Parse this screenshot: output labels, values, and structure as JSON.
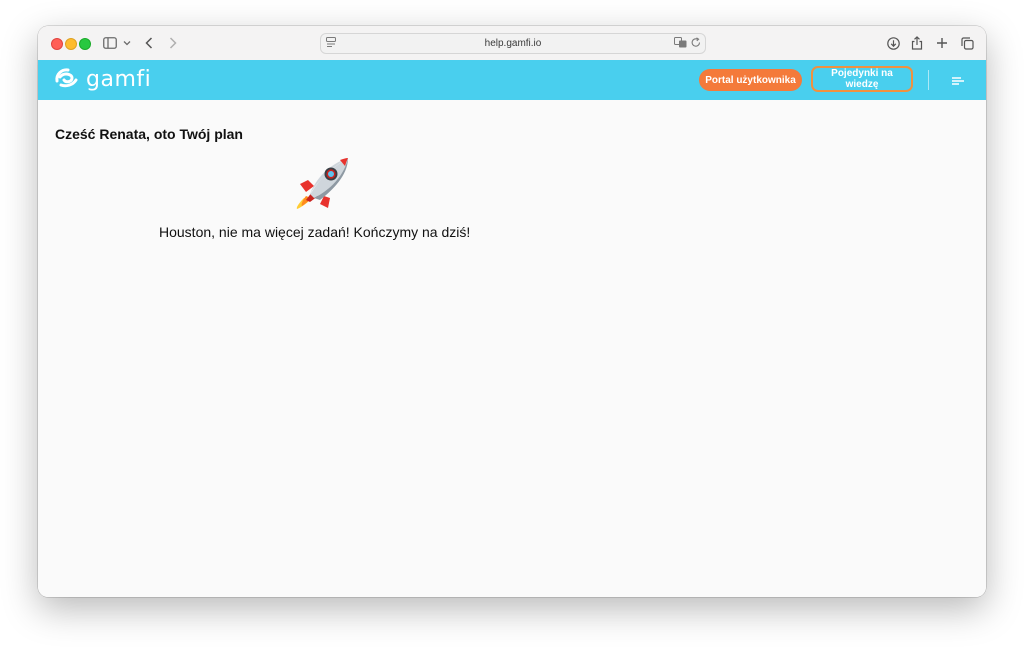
{
  "browser": {
    "url": "help.gamfi.io",
    "icons": [
      "sidebar-icon",
      "chevron-down-icon",
      "back-icon",
      "forward-icon",
      "reader-icon",
      "translate-icon",
      "reload-icon",
      "download-icon",
      "share-icon",
      "new-tab-icon",
      "tabs-overview-icon"
    ]
  },
  "header": {
    "logo_text": "gamfi",
    "portal_button": "Portal użytkownika",
    "duels_button": "Pojedynki na wiedzę",
    "colors": {
      "header_bg": "#49cfee",
      "portal_bg": "#f47a3a",
      "duels_border": "#f0913f"
    }
  },
  "main": {
    "greeting": "Cześć Renata, oto Twój plan",
    "empty_message": "Houston, nie ma więcej zadań! Kończymy na dziś!",
    "illustration": "rocket-icon"
  }
}
